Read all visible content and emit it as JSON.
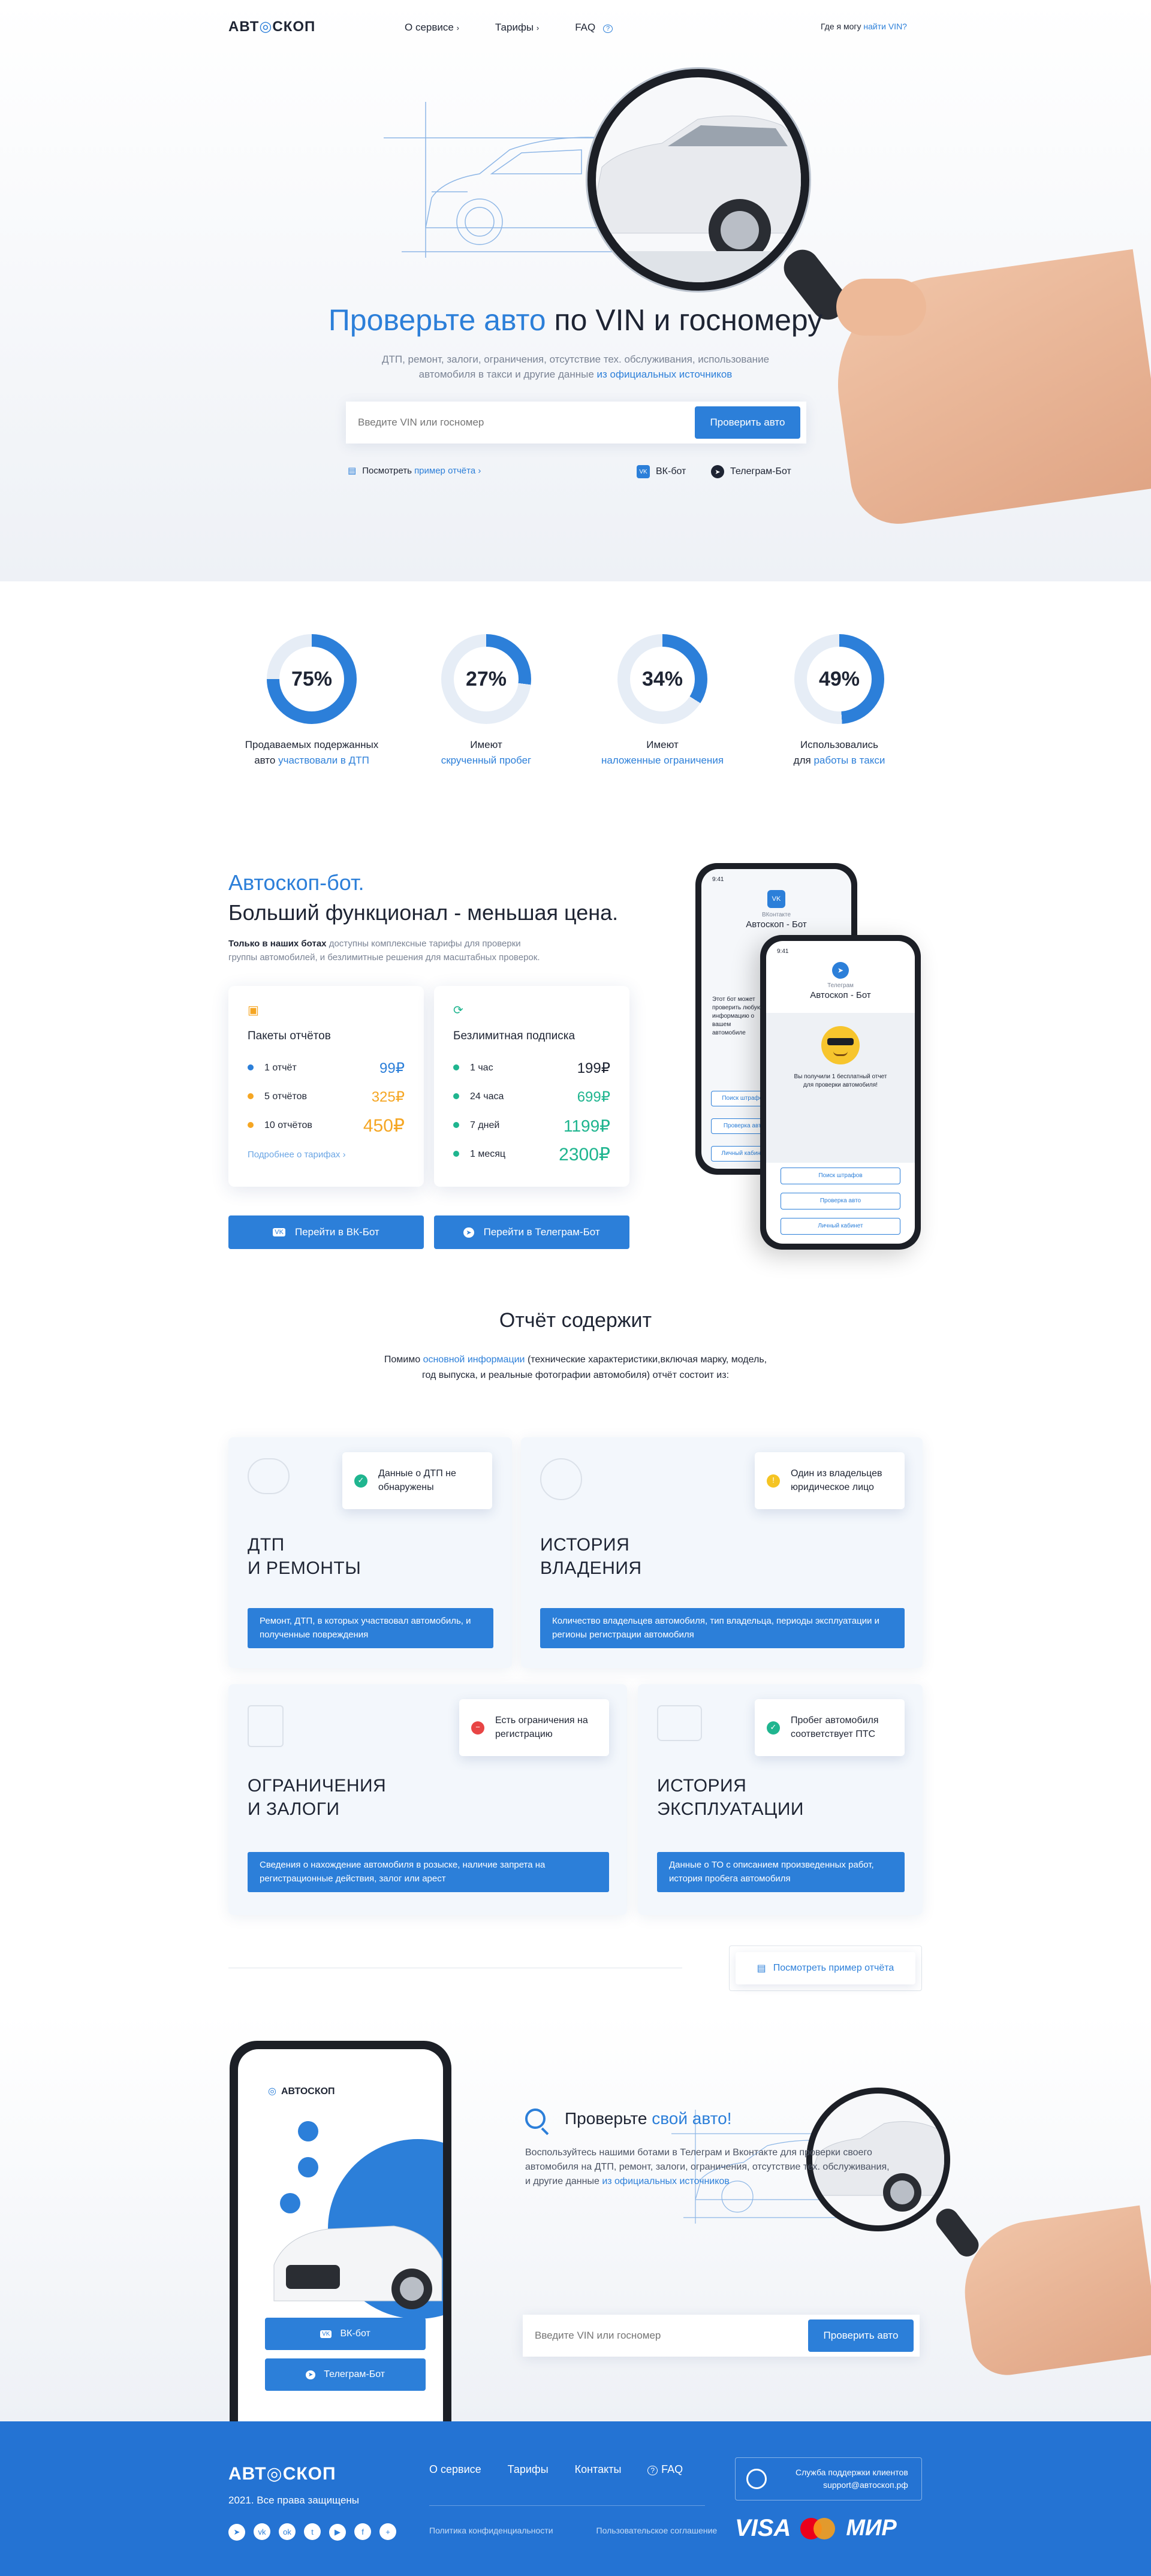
{
  "brand": {
    "logo_left": "АВТ",
    "logo_right": "СКОП"
  },
  "nav": {
    "about": "О сервисе",
    "tariffs": "Тарифы",
    "faq": "FAQ",
    "vin_question": "Где я могу",
    "vin_link": "найти VIN?"
  },
  "hero": {
    "title_blue": "Проверьте авто",
    "title_rest": "по VIN и госномеру",
    "subtitle_1": "ДТП, ремонт, залоги, ограничения, отсутствие тех. обслуживания, использование",
    "subtitle_2": "автомобиля в такси и другие данные",
    "subtitle_link": "из официальных источников",
    "search_placeholder": "Введите VIN или госномер",
    "check_button": "Проверить авто",
    "sample_text": "Посмотреть",
    "sample_link": "пример отчёта ›",
    "vk_bot": "ВК-бот",
    "tg_bot": "Телеграм-Бот"
  },
  "stats": [
    {
      "percent": 75,
      "label": "75%",
      "line1": "Продаваемых подержанных",
      "line2_plain": "авто",
      "line2_blue": "участвовали в ДТП"
    },
    {
      "percent": 27,
      "label": "27%",
      "line1": "Имеют",
      "line2_plain": "",
      "line2_blue": "скрученный пробег"
    },
    {
      "percent": 34,
      "label": "34%",
      "line1": "Имеют",
      "line2_plain": "",
      "line2_blue": "наложенные ограничения"
    },
    {
      "percent": 49,
      "label": "49%",
      "line1": "Использовались",
      "line2_plain": "для",
      "line2_blue": "работы в такси"
    }
  ],
  "bot": {
    "title_blue": "Автоскоп-бот.",
    "title_dark": "Больший функционал - меньшая цена.",
    "desc_bold": "Только в наших ботах",
    "desc_rest_1": "доступны комплексные тарифы для проверки",
    "desc_rest_2": "группы автомобилей, и безлимитные решения для масштабных проверок.",
    "packages": {
      "title": "Пакеты отчётов",
      "rows": [
        {
          "name": "1 отчёт",
          "price": "99₽",
          "color": "#2c7fd9"
        },
        {
          "name": "5 отчётов",
          "price": "325₽",
          "color": "#f5a623"
        },
        {
          "name": "10 отчётов",
          "price": "450₽",
          "color": "#f5a623"
        }
      ],
      "more_link": "Подробнее о тарифах ›"
    },
    "unlimited": {
      "title": "Безлимитная подписка",
      "rows": [
        {
          "name": "1 час",
          "price": "199₽",
          "color": "#1e2433"
        },
        {
          "name": "24 часа",
          "price": "699₽",
          "color": "#1fb58f"
        },
        {
          "name": "7 дней",
          "price": "1199₽",
          "color": "#1fb58f"
        },
        {
          "name": "1 месяц",
          "price": "2300₽",
          "color": "#1fb58f"
        }
      ]
    },
    "vk_button": "Перейти в ВК-Бот",
    "tg_button": "Перейти в Телеграм-Бот",
    "phone_back": {
      "time": "9:41",
      "subtitle": "ВКонтакте",
      "title": "Автоскоп - Бот",
      "text": "Этот бот может проверить любую информацию о вашем автомобиле",
      "btn1": "Поиск штрафов",
      "btn2": "Проверка авто",
      "btn3": "Личный кабинет"
    },
    "phone_front": {
      "time": "9:41",
      "subtitle": "Телеграм",
      "title": "Автоскоп - Бот",
      "text": "Вы получили 1 бесплатный отчет для проверки автомобиля!",
      "btn1": "Поиск штрафов",
      "btn2": "Проверка авто",
      "btn3": "Личный кабинет"
    }
  },
  "report": {
    "title": "Отчёт содержит",
    "intro_1_plain": "Помимо",
    "intro_1_link": "основной информации",
    "intro_1_rest": "(технические характеристики,включая марку, модель,",
    "intro_2": "год выпуска, и реальные фотографии автомобиля) отчёт состоит из:",
    "cards": [
      {
        "title1": "ДТП",
        "title2": "И РЕМОНТЫ",
        "tag": "Данные о ДТП не обнаружены",
        "tag_color": "#1fb58f",
        "tag_icon": "✓",
        "desc": "Ремонт, ДТП, в которых участвовал автомобиль, и полученные повреждения"
      },
      {
        "title1": "ИСТОРИЯ",
        "title2": "ВЛАДЕНИЯ",
        "tag": "Один из владельцев юридическое лицо",
        "tag_color": "#f5c423",
        "tag_icon": "!",
        "desc": "Количество владельцев автомобиля, тип владельца, периоды эксплуатации и регионы регистрации автомобиля"
      },
      {
        "title1": "ОГРАНИЧЕНИЯ",
        "title2": "И ЗАЛОГИ",
        "tag": "Есть ограничения на регистрацию",
        "tag_color": "#e84545",
        "tag_icon": "−",
        "desc": "Сведения о нахождение автомобиля в розыске, наличие запрета на регистрационные действия, залог или арест"
      },
      {
        "title1": "ИСТОРИЯ",
        "title2": "ЭКСПЛУАТАЦИИ",
        "tag": "Пробег автомобиля соответствует ПТС",
        "tag_color": "#1fb58f",
        "tag_icon": "✓",
        "desc": "Данные о ТО с описанием произведенных работ, история пробега автомобиля"
      }
    ],
    "sample_button": "Посмотреть пример отчёта"
  },
  "cta": {
    "phone_logo": "АВТОСКОП",
    "phone_vk": "ВК-бот",
    "phone_tg": "Телеграм-Бот",
    "title_plain": "Проверьте",
    "title_blue": "свой авто!",
    "desc_1": "Воспользуйтесь нашими ботами в Телеграм и Вконтакте для проверки своего",
    "desc_2": "автомобиля на ДТП, ремонт, залоги, ограничения, отсутствие тех. обслуживания,",
    "desc_3": "и другие данные",
    "desc_link": "из официальных источников",
    "search_placeholder": "Введите VIN или госномер",
    "check_button": "Проверить авто"
  },
  "footer": {
    "logo_left": "АВТ",
    "logo_right": "СКОП",
    "copyright": "2021. Все права защищены",
    "links": [
      "О сервисе",
      "Тарифы",
      "Контакты",
      "FAQ"
    ],
    "privacy": "Политика конфиденциальности",
    "agreement": "Пользовательское соглашение",
    "support_title": "Служба поддержки клиентов",
    "support_email": "support@автоскоп.рф",
    "pay_visa": "VISA",
    "pay_mir": "МИР"
  },
  "colors": {
    "accent": "#2c7fd9",
    "footer_bg": "#2473d3",
    "green": "#1fb58f",
    "orange": "#f5a623",
    "red": "#e84545"
  }
}
